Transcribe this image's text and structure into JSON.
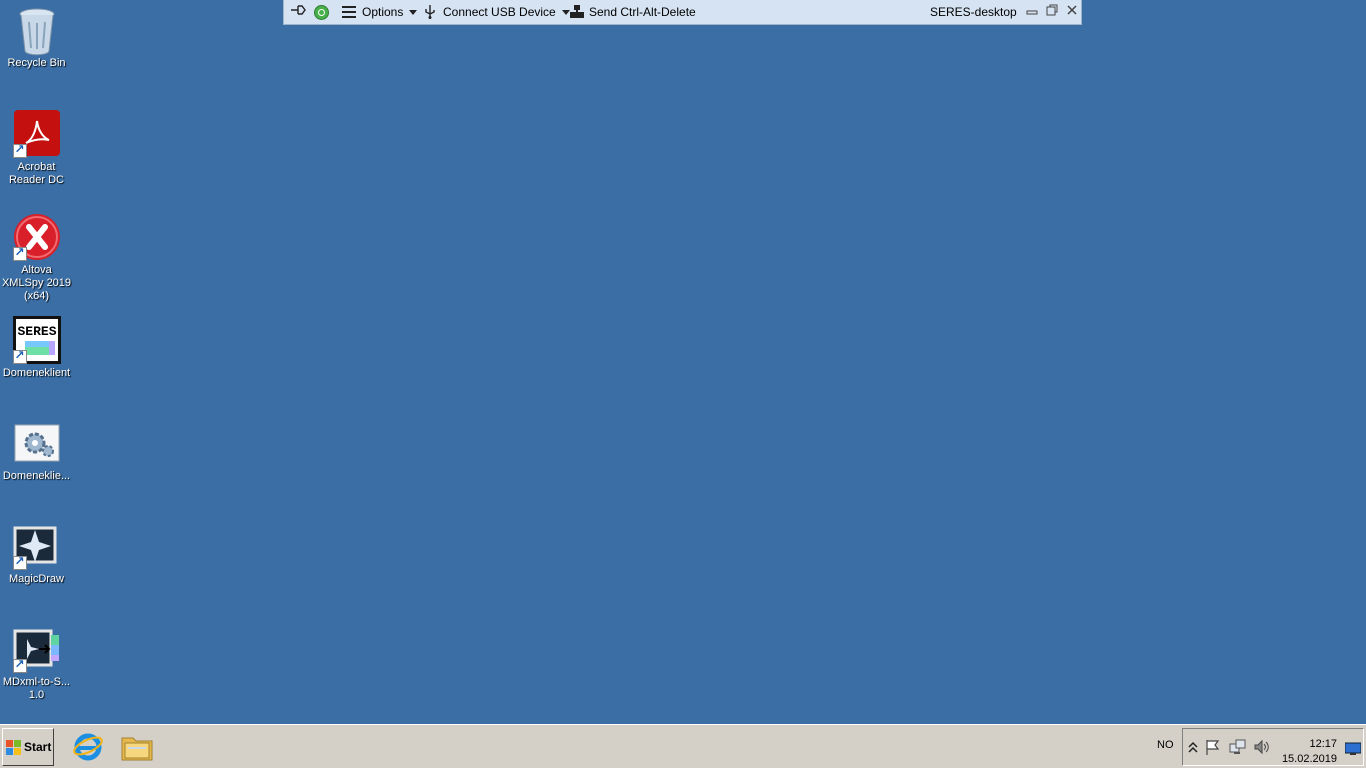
{
  "remote_toolbar": {
    "options_label": "Options",
    "usb_label": "Connect USB Device",
    "cad_label": "Send Ctrl-Alt-Delete",
    "host_name": "SERES-desktop"
  },
  "desktop_icons": [
    {
      "label": "Recycle Bin",
      "icon": "recycle-bin-icon"
    },
    {
      "label": "Acrobat Reader DC",
      "icon": "acrobat-icon"
    },
    {
      "label": "Altova XMLSpy 2019 (x64)",
      "icon": "xmlspy-icon"
    },
    {
      "label": "Domeneklient",
      "icon": "seres-icon"
    },
    {
      "label": "Domeneklie...",
      "icon": "gear-app-icon"
    },
    {
      "label": "MagicDraw",
      "icon": "magicdraw-icon"
    },
    {
      "label": "MDxml-to-S... 1.0",
      "icon": "mdxml-icon"
    }
  ],
  "taskbar": {
    "start_label": "Start",
    "language": "NO",
    "time": "12:17",
    "date": "15.02.2019"
  },
  "colors": {
    "desktop": "#3a6ea5",
    "taskbar": "#d4d0c8",
    "toolbar": "#d6e3f3"
  }
}
